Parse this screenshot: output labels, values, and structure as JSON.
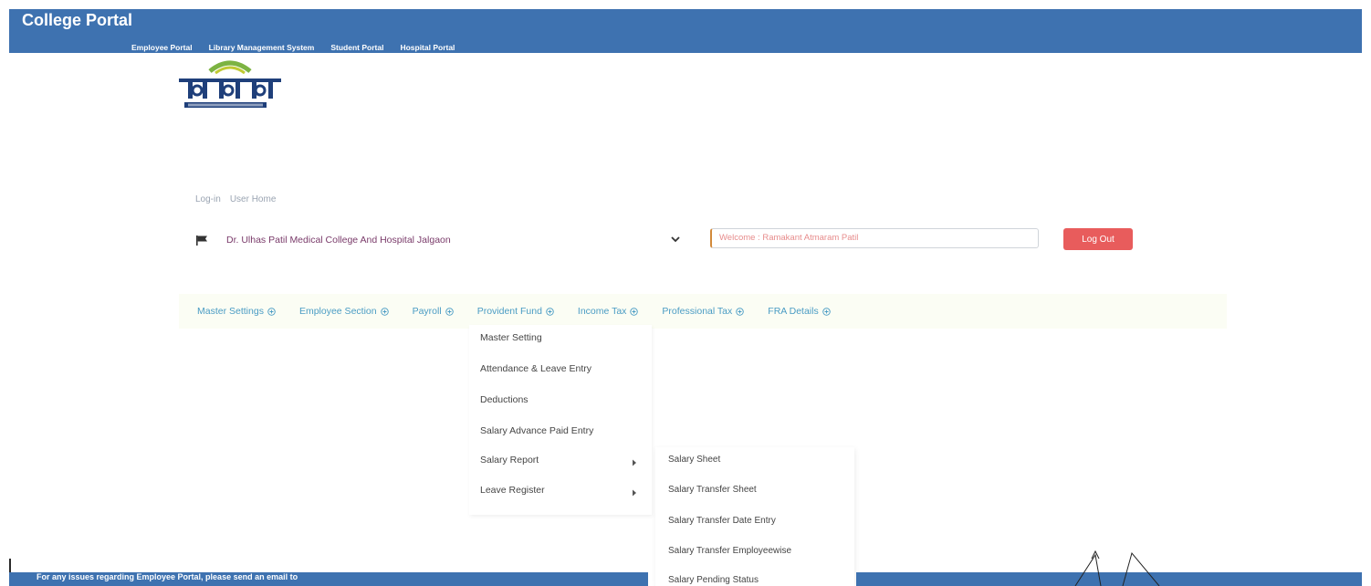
{
  "header": {
    "title": "College Portal",
    "portal_links": [
      "Employee Portal",
      "Library Management System",
      "Student Portal",
      "Hospital Portal"
    ]
  },
  "breadcrumb": [
    "Log-in",
    "User Home"
  ],
  "college_select": {
    "value": "Dr. Ulhas Patil Medical College And Hospital Jalgaon"
  },
  "welcome_text": "Welcome : Ramakant Atmaram Patil",
  "logout_label": "Log Out",
  "nav_menu": [
    "Master Settings",
    "Employee Section",
    "Payroll",
    "Provident Fund",
    "Income Tax",
    "Professional Tax",
    "FRA Details"
  ],
  "payroll_menu": [
    "Master Setting",
    "Attendance & Leave Entry",
    "Deductions",
    "Salary Advance Paid Entry",
    "Salary Report",
    "Leave Register"
  ],
  "salary_report_submenu": [
    "Salary Sheet",
    "Salary Transfer Sheet",
    "Salary Transfer Date Entry",
    "Salary Transfer Employeewise",
    "Salary Pending Status"
  ],
  "footer": {
    "note": "For any issues regarding Employee Portal, please send an email to"
  },
  "colors": {
    "header_bg": "#3e72b0",
    "nav_text": "#4a9cc4",
    "logout_bg": "#e85c5c",
    "college_text": "#7a3b6a",
    "welcome_text": "#e78c8c"
  },
  "icons": {
    "flag": "flag-icon",
    "chevron": "chevron-down-icon",
    "nav_plus": "plus-circle-icon",
    "submenu_arrow": "caret-right-icon"
  }
}
